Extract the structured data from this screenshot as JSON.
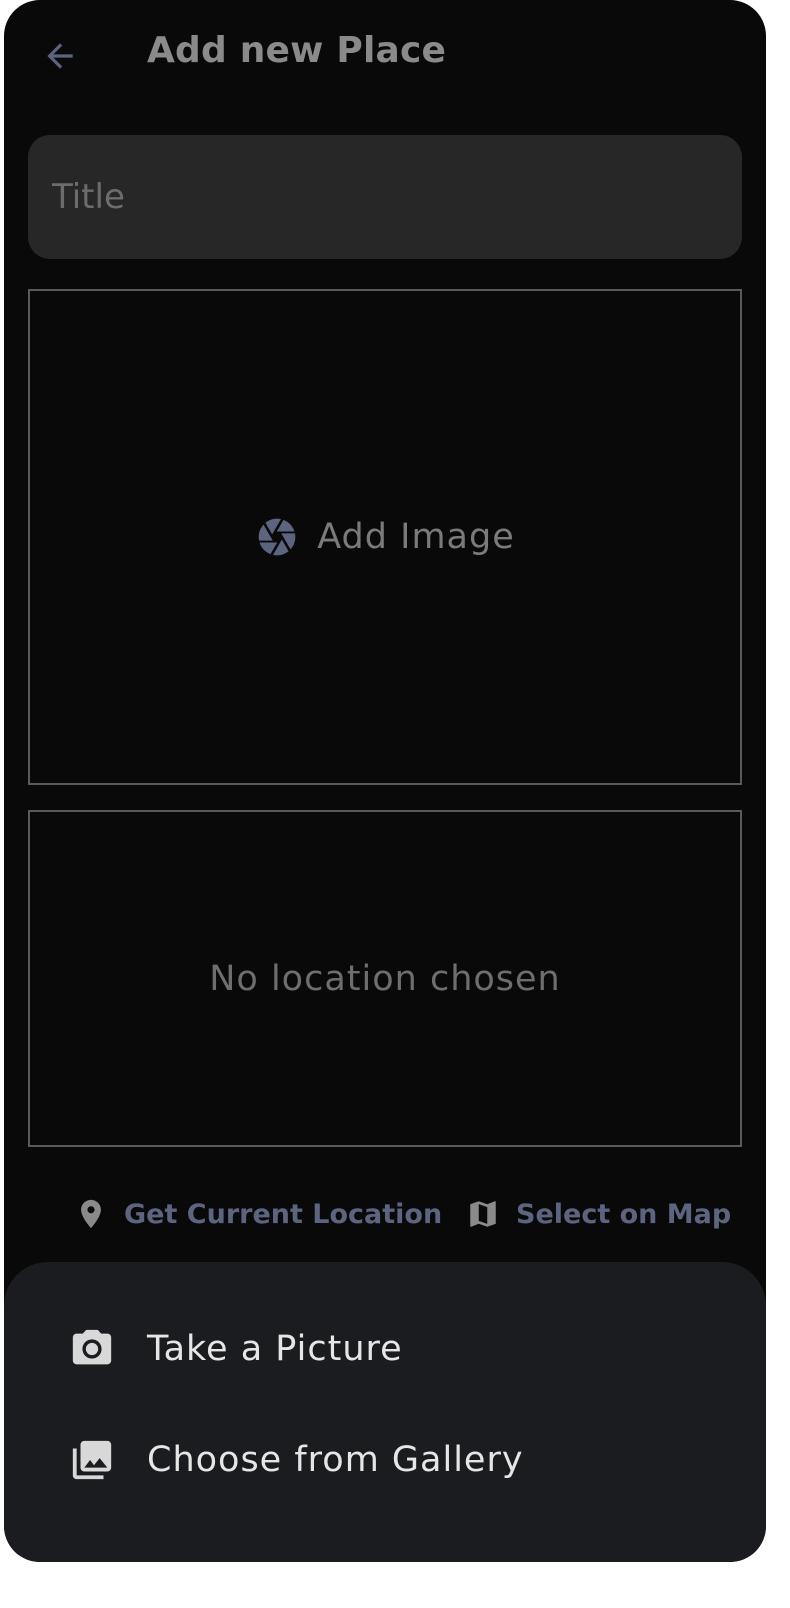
{
  "appbar": {
    "title": "Add new Place",
    "back_icon": "arrow-back-icon"
  },
  "form": {
    "title_placeholder": "Title",
    "title_value": ""
  },
  "image_picker": {
    "label": "Add Image",
    "icon": "camera-aperture-icon"
  },
  "location": {
    "status_text": "No location chosen",
    "get_current_label": "Get Current Location",
    "get_current_icon": "location-pin-icon",
    "select_on_map_label": "Select on Map",
    "select_on_map_icon": "map-icon"
  },
  "bottom_sheet": {
    "items": [
      {
        "label": "Take a Picture",
        "icon": "camera-icon"
      },
      {
        "label": "Choose from Gallery",
        "icon": "photo-library-icon"
      }
    ]
  },
  "colors": {
    "background": "#090909",
    "surface": "#272727",
    "sheet": "#1b1c20",
    "accent": "#5c6480",
    "border": "#5a5a5a"
  }
}
